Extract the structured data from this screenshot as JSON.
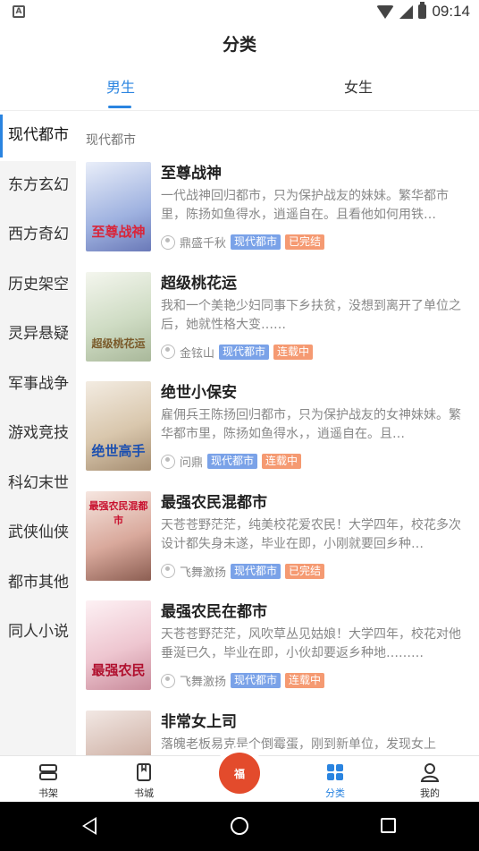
{
  "statusbar": {
    "time": "09:14",
    "notification_icon": "A"
  },
  "header": {
    "title": "分类"
  },
  "tabs": [
    {
      "label": "男生",
      "active": true
    },
    {
      "label": "女生",
      "active": false
    }
  ],
  "sidebar": {
    "items": [
      {
        "label": "现代都市",
        "active": true
      },
      {
        "label": "东方玄幻"
      },
      {
        "label": "西方奇幻"
      },
      {
        "label": "历史架空"
      },
      {
        "label": "灵异悬疑"
      },
      {
        "label": "军事战争"
      },
      {
        "label": "游戏竞技"
      },
      {
        "label": "科幻末世"
      },
      {
        "label": "武侠仙侠"
      },
      {
        "label": "都市其他"
      },
      {
        "label": "同人小说"
      }
    ]
  },
  "section": {
    "title": "现代都市"
  },
  "books": [
    {
      "title": "至尊战神",
      "desc": "一代战神回归都市，只为保护战友的妹妹。繁华都市里，陈扬如鱼得水，逍遥自在。且看他如何用铁…",
      "author": "鼎盛千秋",
      "category": "现代都市",
      "status": "已完结",
      "cover_text": "至尊战神",
      "cover_bg": "#b8c6e8"
    },
    {
      "title": "超级桃花运",
      "desc": "我和一个美艳少妇同事下乡扶贫，没想到离开了单位之后，她就性格大变……",
      "author": "金铉山",
      "category": "现代都市",
      "status": "连载中",
      "cover_text": "超级桃花运",
      "cover_bg": "#d8e4d0"
    },
    {
      "title": "绝世小保安",
      "desc": "雇佣兵王陈扬回归都市，只为保护战友的女神妹妹。繁华都市里，陈扬如鱼得水，，逍遥自在。且…",
      "author": "问鼎",
      "category": "现代都市",
      "status": "连载中",
      "cover_text": "绝世高手",
      "cover_bg": "#e6dccd"
    },
    {
      "title": "最强农民混都市",
      "desc": "天苍苍野茫茫，纯美校花爱农民！大学四年，校花多次设计都失身未遂，毕业在即，小刚就要回乡种…",
      "author": "飞舞激扬",
      "category": "现代都市",
      "status": "已完结",
      "cover_text": "最强农民混都市",
      "cover_bg": "#e8cfc8"
    },
    {
      "title": "最强农民在都市",
      "desc": "天苍苍野茫茫，风吹草丛见姑娘！大学四年，校花对他垂涎已久，毕业在即，小伙却要返乡种地………",
      "author": "飞舞激扬",
      "category": "现代都市",
      "status": "连载中",
      "cover_text": "最强农民",
      "cover_bg": "#f0d6dc"
    },
    {
      "title": "非常女上司",
      "desc": "落魄老板易克是个倒霉蛋，刚到新单位，发现女上",
      "author": "",
      "category": "",
      "status": "",
      "cover_text": "",
      "cover_bg": "#d9c9c2"
    }
  ],
  "bottomnav": {
    "items": [
      {
        "label": "书架",
        "icon": "bookshelf-icon"
      },
      {
        "label": "书城",
        "icon": "bookstore-icon"
      },
      {
        "label": "",
        "icon": "welfare-icon",
        "center_text": "福"
      },
      {
        "label": "分类",
        "icon": "category-icon",
        "active": true
      },
      {
        "label": "我的",
        "icon": "profile-icon"
      }
    ]
  },
  "colors": {
    "accent": "#2a84e0",
    "tag_category": "#7aa2e8",
    "tag_status": "#f59a72",
    "center_button": "#e34b2c"
  }
}
